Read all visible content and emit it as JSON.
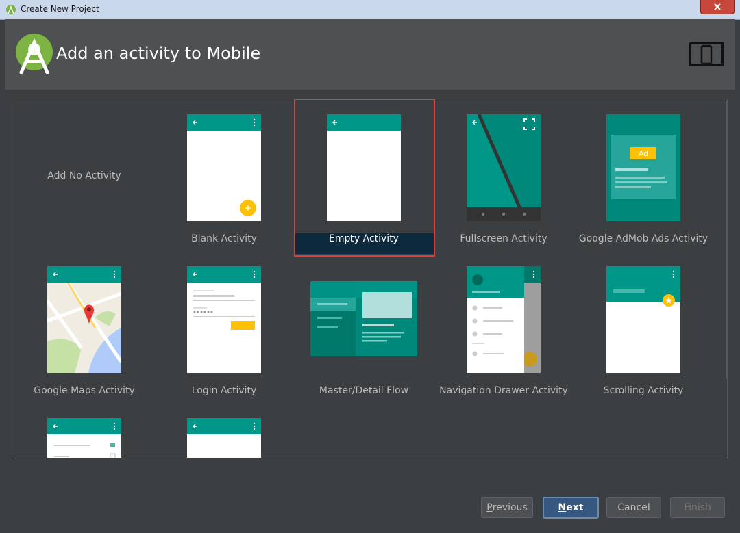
{
  "window": {
    "title": "Create New Project",
    "close_icon": "close-icon"
  },
  "header": {
    "title": "Add an activity to Mobile",
    "logo": "android-studio-logo",
    "device_icon": "phone-tablet-icon"
  },
  "gallery": {
    "no_activity_label": "Add No Activity",
    "selected": "Empty Activity",
    "tiles": [
      {
        "label": "Blank Activity"
      },
      {
        "label": "Empty Activity"
      },
      {
        "label": "Fullscreen Activity"
      },
      {
        "label": "Google AdMob Ads Activity"
      },
      {
        "label": "Google Maps Activity"
      },
      {
        "label": "Login Activity"
      },
      {
        "label": "Master/Detail Flow"
      },
      {
        "label": "Navigation Drawer Activity"
      },
      {
        "label": "Scrolling Activity"
      }
    ],
    "ad_badge": "Ad"
  },
  "buttons": {
    "previous": "Previous",
    "previous_mnemonic": "P",
    "next": "Next",
    "next_mnemonic": "N",
    "cancel": "Cancel",
    "finish": "Finish"
  },
  "colors": {
    "teal": "#009688",
    "teal_dark": "#00897b",
    "accent_yellow": "#ffc107",
    "selection_border": "#e03c3c"
  }
}
